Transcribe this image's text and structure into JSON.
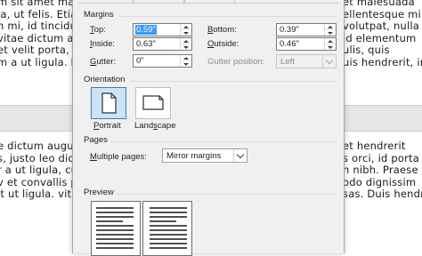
{
  "document": {
    "left_lines": [
      "m sit amet mauris",
      "ia, ut felis. Etiam",
      "n mi, id tincidunt",
      "vitae dictum augue",
      "et velit porta, phar",
      "m a ut ligula. Morbi",
      "",
      "",
      "",
      "",
      "",
      "e dictum augue le",
      "s, justo leo dictum",
      "r a ut ligula, cursu",
      "v et convallis phar",
      "it ut ligula. vitae di",
      "",
      ""
    ],
    "right_lines": [
      "et malesuada",
      "ellentesque mi",
      "volutpat, nulla",
      "id elementum",
      "ulis, quis",
      "uis hendrerit, in",
      "",
      "",
      "",
      "",
      "",
      "et hendrerit",
      "s orci, id porta",
      "n nibh. Praese",
      "odo dignissim",
      "sas. Duis hendr",
      ""
    ]
  },
  "dialog": {
    "margins": {
      "section_label": "Margins",
      "top": {
        "label": "Top:",
        "accel": "T",
        "rest": "op:",
        "value": "0.59\""
      },
      "bottom": {
        "label": "Bottom:",
        "accel": "B",
        "rest": "ottom:",
        "value": "0.39\""
      },
      "inside": {
        "label": "Inside:",
        "accel": "I",
        "rest": "nside:",
        "value": "0.63\""
      },
      "outside": {
        "label": "Outside:",
        "accel": "O",
        "rest": "utside:",
        "value": "0.46\""
      },
      "gutter": {
        "label": "Gutter:",
        "accel": "G",
        "rest": "utter:",
        "value": "0\""
      },
      "gutter_position": {
        "label": "Gutter position:",
        "value": "Left"
      }
    },
    "orientation": {
      "section_label": "Orientation",
      "portrait_label": "Portrait",
      "portrait_accel": "P",
      "portrait_rest": "ortrait",
      "landscape_label": "Landscape",
      "landscape_pre": "Land",
      "landscape_accel": "s",
      "landscape_rest": "cape"
    },
    "pages": {
      "section_label": "Pages",
      "multiple_pages_label": "Multiple pages:",
      "multiple_pages_pre": "",
      "multiple_pages_accel": "M",
      "multiple_pages_rest": "ultiple pages:",
      "multiple_pages_value": "Mirror margins"
    },
    "preview": {
      "section_label": "Preview"
    }
  }
}
